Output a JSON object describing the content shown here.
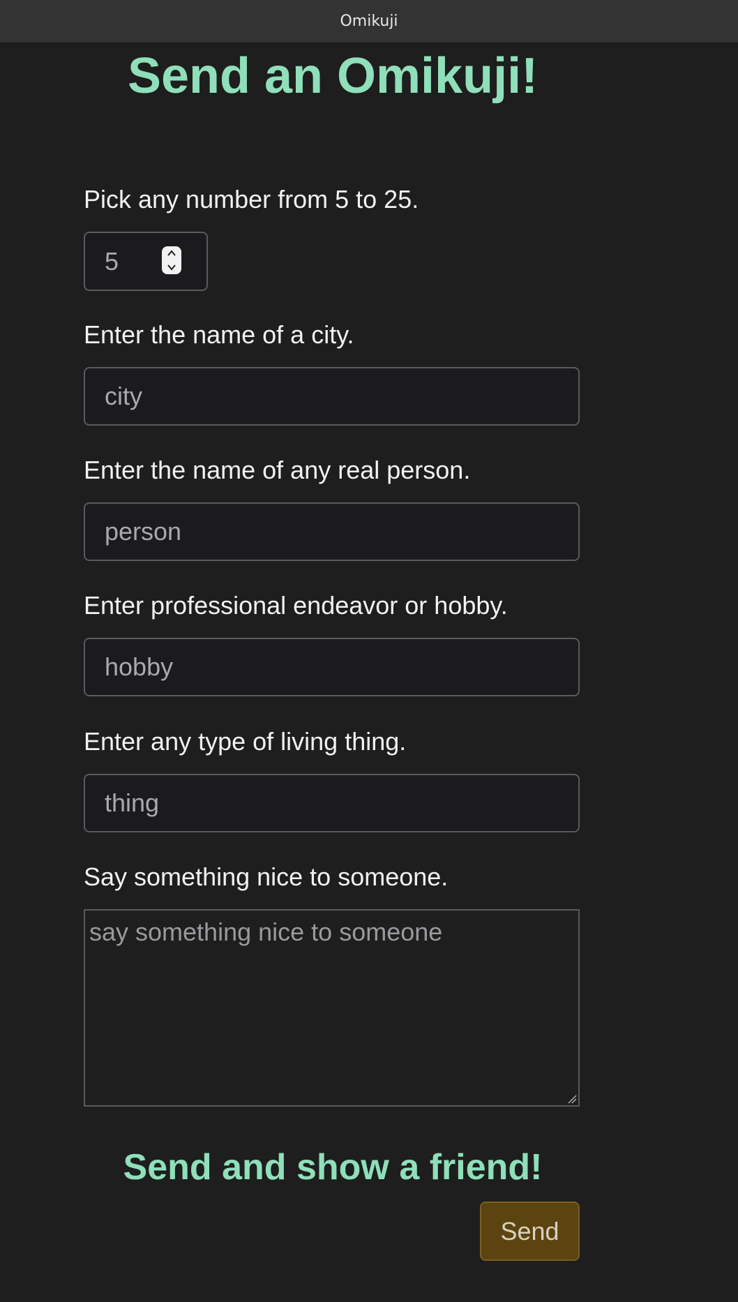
{
  "window": {
    "title": "Omikuji"
  },
  "page": {
    "title": "Send an Omikuji!"
  },
  "form": {
    "number": {
      "label": "Pick any number from 5 to 25.",
      "value": "5"
    },
    "city": {
      "label": "Enter the name of a city.",
      "placeholder": "city"
    },
    "person": {
      "label": "Enter the name of any real person.",
      "placeholder": "person"
    },
    "hobby": {
      "label": "Enter professional endeavor or hobby.",
      "placeholder": "hobby"
    },
    "thing": {
      "label": "Enter any type of living thing.",
      "placeholder": "thing"
    },
    "nice": {
      "label": "Say something nice to someone.",
      "placeholder": "say something nice to someone"
    }
  },
  "footer": {
    "heading": "Send and show a friend!",
    "send_label": "Send"
  },
  "colors": {
    "accent": "#8fdfba",
    "background": "#1e1e1e",
    "button": "#5c4410"
  }
}
